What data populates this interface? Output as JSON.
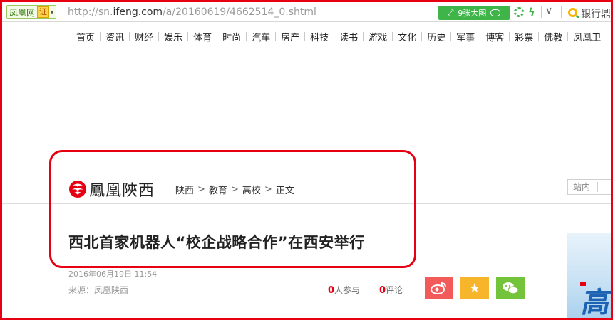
{
  "browser": {
    "site_name": "凤凰网",
    "cert_label": "证",
    "url_prefix": "http://sn.",
    "url_domain": "ifeng.com",
    "url_path": "/a/20160619/4662514_0.shtml",
    "big_pic_label": "9张大图",
    "search_hint": "银行鼎",
    "accent_color": "#3fb449"
  },
  "nav": {
    "items": [
      "首页",
      "资讯",
      "财经",
      "娱乐",
      "体育",
      "时尚",
      "汽车",
      "房产",
      "科技",
      "读书",
      "游戏",
      "文化",
      "历史",
      "军事",
      "博客",
      "彩票",
      "佛教",
      "凤凰卫"
    ]
  },
  "header": {
    "logo_text": "鳳凰陝西",
    "breadcrumb": [
      "陕西",
      "教育",
      "高校",
      "正文"
    ],
    "site_search_label": "站内"
  },
  "article": {
    "title": "西北首家机器人“校企战略合作”在西安举行",
    "date": "2016年06月19日  11:54",
    "source": "来源：凤凰陕西",
    "participants_count": "0",
    "participants_label": "人参与",
    "comments_count": "0",
    "comments_label": "评论"
  },
  "ad": {
    "visible_glyph": "高"
  },
  "colors": {
    "highlight": "#e60012",
    "weibo": "#f35a5a",
    "favorite": "#f7b52c",
    "wechat": "#73c33b"
  }
}
